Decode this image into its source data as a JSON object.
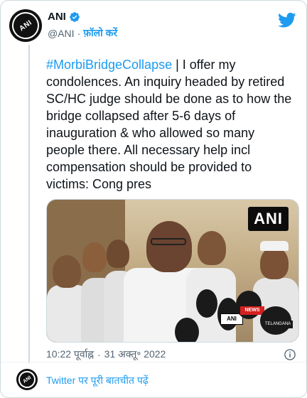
{
  "header": {
    "name": "ANI",
    "handle": "@ANI",
    "separator": "·",
    "follow_label": "फ़ॉलो करें",
    "avatar_text": "ANI"
  },
  "tweet": {
    "hashtag": "#MorbiBridgeCollapse",
    "body": " | I offer my condolences. An inquiry headed by retired SC/HC judge should be done as to how the bridge collapsed after 5-6 days of inauguration & who allowed so many people there. All necessary help incl compensation should be provided to victims: Cong pres"
  },
  "media": {
    "watermark": "ANI",
    "mic_labels": [
      "ANI",
      "NEWS",
      "TELANGANA"
    ]
  },
  "meta": {
    "time": "10:22 पूर्वाह्न",
    "separator": "·",
    "date": "31 अक्तू॰ 2022"
  },
  "footer": {
    "link_label": "Twitter पर पूरी बातचीत पढ़ें",
    "avatar_text": "ANI"
  },
  "colors": {
    "accent": "#1d9bf0",
    "text": "#0f1419",
    "muted": "#536471",
    "border": "#cfd9de"
  },
  "icons": {
    "verified": "verified-badge-icon",
    "brand": "twitter-bird-icon",
    "info": "info-icon"
  }
}
